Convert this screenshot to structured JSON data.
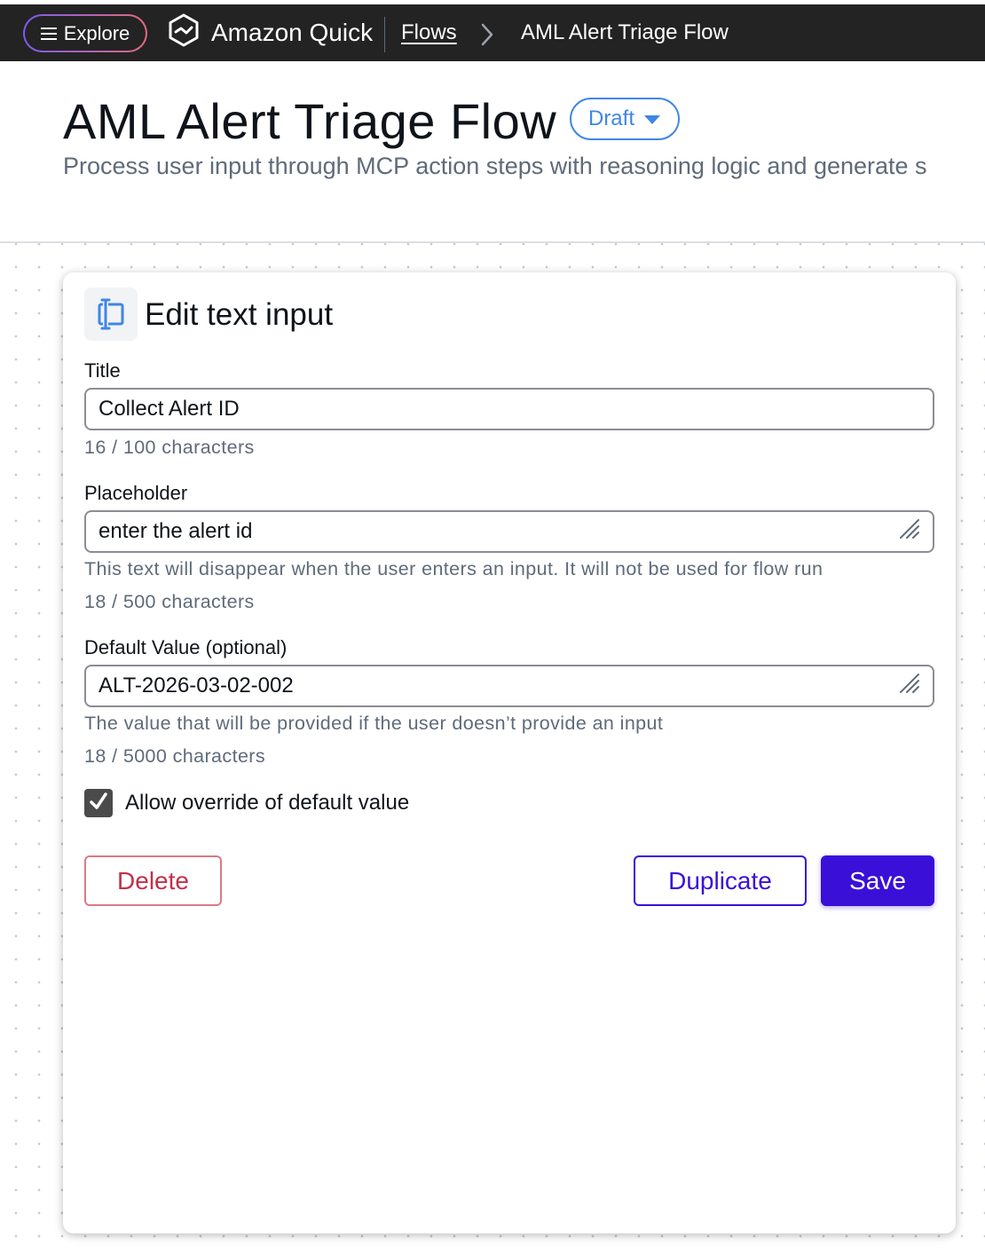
{
  "topbar": {
    "explore_label": "Explore",
    "brand_name": "Amazon Quick",
    "breadcrumb_link": "Flows",
    "breadcrumb_current": "AML Alert Triage Flow"
  },
  "header": {
    "title": "AML Alert Triage Flow",
    "status": "Draft",
    "description": "Process user input through MCP action steps with reasoning logic and generate s"
  },
  "panel": {
    "title": "Edit text input",
    "title_field": {
      "label": "Title",
      "value": "Collect Alert ID",
      "count": "16 / 100 characters"
    },
    "placeholder_field": {
      "label": "Placeholder",
      "value": "enter the alert id",
      "hint": "This text will disappear when the user enters an input. It will not be used for flow run",
      "count": "18 / 500 characters"
    },
    "default_field": {
      "label": "Default Value (optional)",
      "value": "ALT-2026-03-02-002",
      "hint": "The value that will be provided if the user doesn’t provide an input",
      "count": "18 / 5000 characters"
    },
    "allow_override": {
      "label": "Allow override of default value",
      "checked": true
    },
    "buttons": {
      "delete": "Delete",
      "duplicate": "Duplicate",
      "save": "Save"
    }
  },
  "colors": {
    "topbar_bg": "#232323",
    "primary": "#3a10d8",
    "danger": "#c0314a",
    "status_blue": "#3f86e6"
  },
  "icons": [
    "menu-icon",
    "amazon-quick-logo-icon",
    "chevron-right-icon",
    "caret-down-icon",
    "text-input-icon",
    "resize-handle-icon",
    "checkmark-icon"
  ]
}
